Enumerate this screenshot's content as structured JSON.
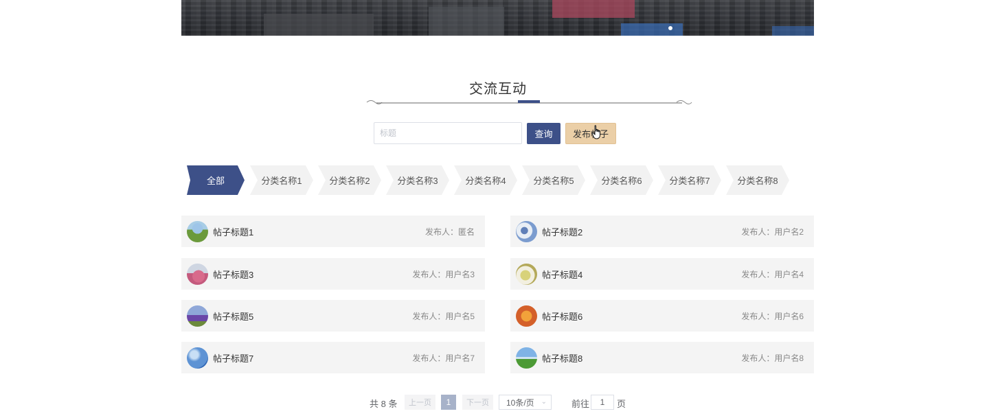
{
  "section": {
    "title": "交流互动"
  },
  "search": {
    "placeholder": "标题",
    "value": "",
    "query_label": "查询",
    "post_label": "发布帖子"
  },
  "categories": [
    {
      "label": "全部",
      "active": true
    },
    {
      "label": "分类名称1"
    },
    {
      "label": "分类名称2"
    },
    {
      "label": "分类名称3"
    },
    {
      "label": "分类名称4"
    },
    {
      "label": "分类名称5"
    },
    {
      "label": "分类名称6"
    },
    {
      "label": "分类名称7"
    },
    {
      "label": "分类名称8"
    }
  ],
  "posts": [
    {
      "title": "帖子标题1",
      "author": "发布人：匿名"
    },
    {
      "title": "帖子标题2",
      "author": "发布人：用户名2"
    },
    {
      "title": "帖子标题3",
      "author": "发布人：用户名3"
    },
    {
      "title": "帖子标题4",
      "author": "发布人：用户名4"
    },
    {
      "title": "帖子标题5",
      "author": "发布人：用户名5"
    },
    {
      "title": "帖子标题6",
      "author": "发布人：用户名6"
    },
    {
      "title": "帖子标题7",
      "author": "发布人：用户名7"
    },
    {
      "title": "帖子标题8",
      "author": "发布人：用户名8"
    }
  ],
  "pagination": {
    "total": "共 8 条",
    "prev_label": "上一页",
    "next_label": "下一页",
    "current_page": "1",
    "page_size": "10条/页",
    "goto_label": "前往",
    "goto_value": "1",
    "page_unit": "页"
  },
  "colors": {
    "accent": "#3d5088",
    "post_button": "#ebcfa7",
    "card_bg": "#f4f4f4"
  }
}
